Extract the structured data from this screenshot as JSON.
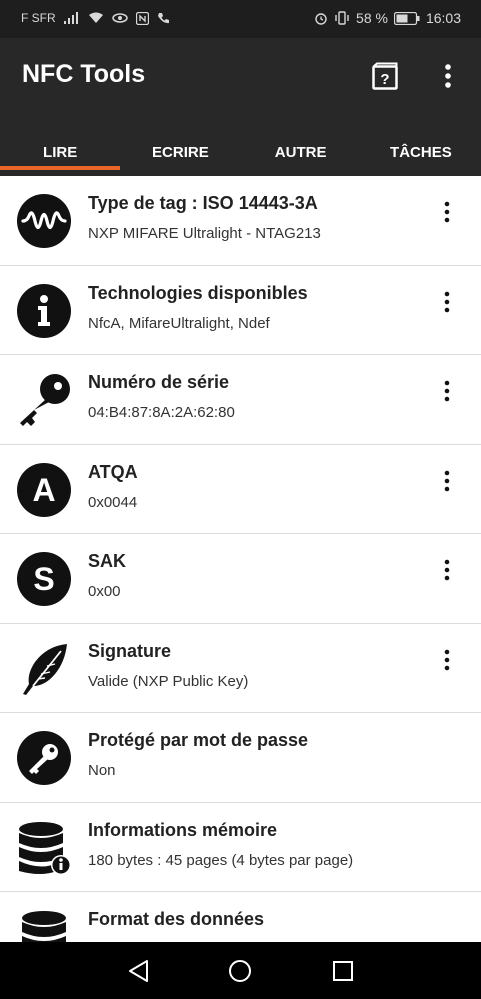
{
  "status": {
    "carrier": "F SFR",
    "battery": "58 %",
    "time": "16:03"
  },
  "app": {
    "title": "NFC Tools"
  },
  "tabs": [
    {
      "label": "LIRE"
    },
    {
      "label": "ECRIRE"
    },
    {
      "label": "AUTRE"
    },
    {
      "label": "TÂCHES"
    }
  ],
  "items": [
    {
      "title": "Type de tag : ISO 14443-3A",
      "subtitle": "NXP MIFARE Ultralight - NTAG213",
      "icon": "waveform-icon",
      "menu": true
    },
    {
      "title": "Technologies disponibles",
      "subtitle": "NfcA, MifareUltralight, Ndef",
      "icon": "info-icon",
      "menu": true
    },
    {
      "title": "Numéro de série",
      "subtitle": "04:B4:87:8A:2A:62:80",
      "icon": "key-icon",
      "menu": true
    },
    {
      "title": "ATQA",
      "subtitle": "0x0044",
      "icon": "letter-a-icon",
      "menu": true
    },
    {
      "title": "SAK",
      "subtitle": "0x00",
      "icon": "letter-s-icon",
      "menu": true
    },
    {
      "title": "Signature",
      "subtitle": "Valide (NXP Public Key)",
      "icon": "feather-icon",
      "menu": true
    },
    {
      "title": "Protégé par mot de passe",
      "subtitle": "Non",
      "icon": "key-circle-icon",
      "menu": false
    },
    {
      "title": "Informations mémoire",
      "subtitle": "180 bytes : 45 pages (4 bytes par page)",
      "icon": "database-info-icon",
      "menu": false
    },
    {
      "title": "Format des données",
      "subtitle": "",
      "icon": "database-icon",
      "menu": false
    }
  ],
  "colors": {
    "app_bar": "#282828",
    "status_bar": "#1e1e1e",
    "accent": "#e8662c"
  }
}
